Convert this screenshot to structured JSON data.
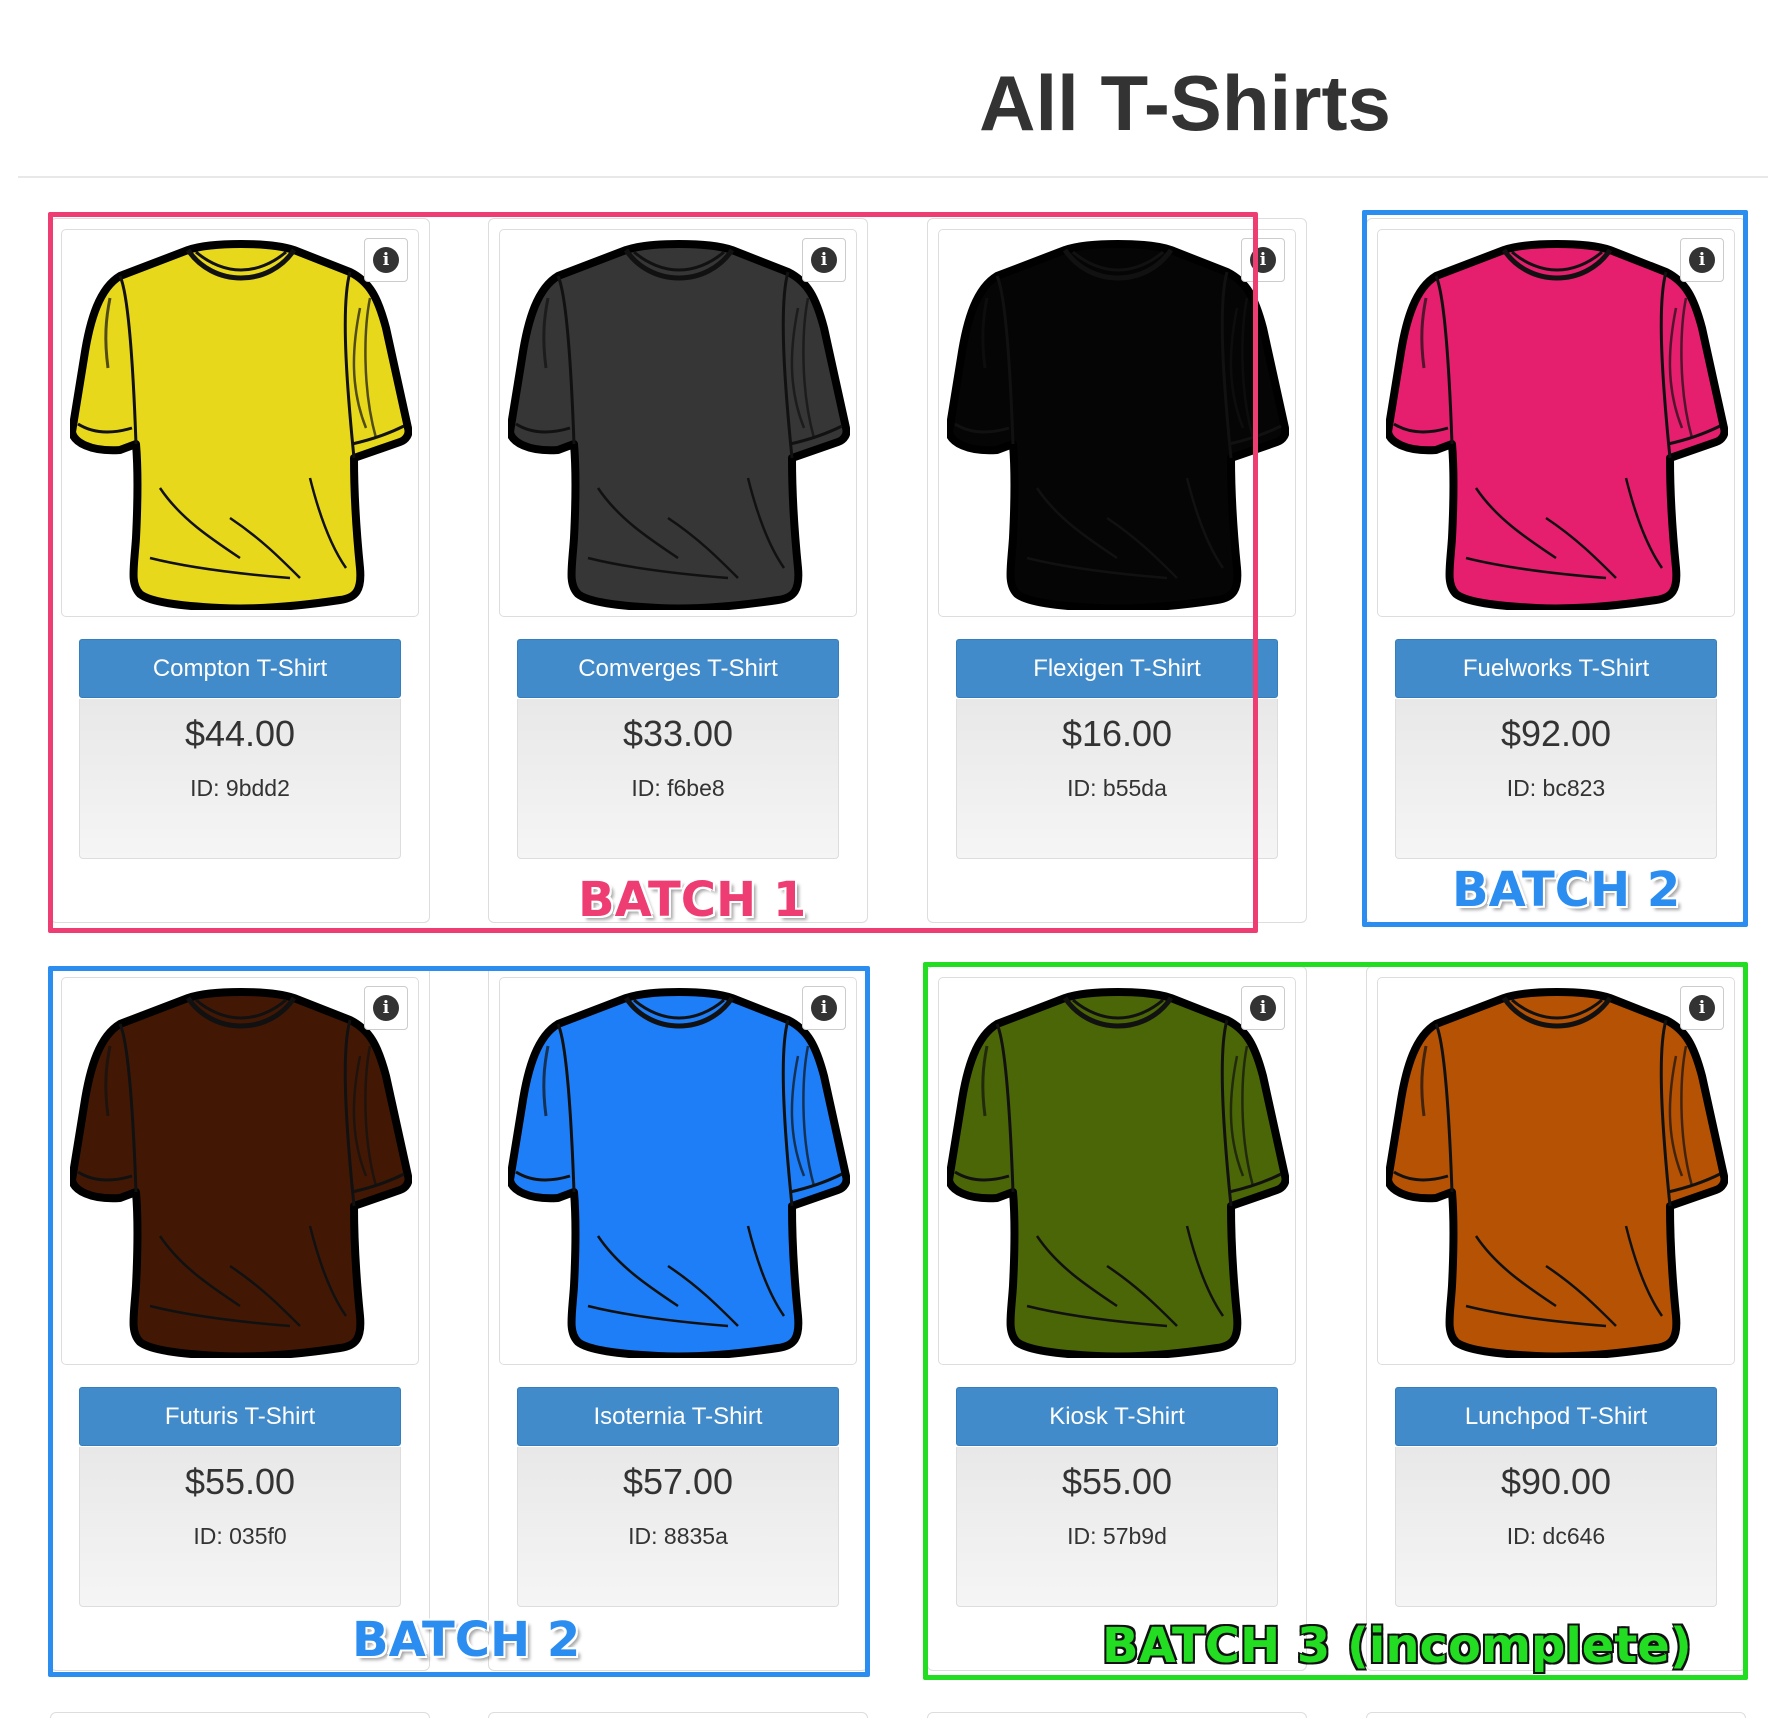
{
  "page": {
    "title": "All T-Shirts"
  },
  "products": [
    {
      "name": "Compton T-Shirt",
      "price": "$44.00",
      "id": "ID: 9bdd2",
      "color": "#e8d81c",
      "info_icon": "i"
    },
    {
      "name": "Comverges T-Shirt",
      "price": "$33.00",
      "id": "ID: f6be8",
      "color": "#363636",
      "info_icon": "i"
    },
    {
      "name": "Flexigen T-Shirt",
      "price": "$16.00",
      "id": "ID: b55da",
      "color": "#050505",
      "info_icon": "i"
    },
    {
      "name": "Fuelworks T-Shirt",
      "price": "$92.00",
      "id": "ID: bc823",
      "color": "#e61e6e",
      "info_icon": "i"
    },
    {
      "name": "Futuris T-Shirt",
      "price": "$55.00",
      "id": "ID: 035f0",
      "color": "#421805",
      "info_icon": "i"
    },
    {
      "name": "Isoternia T-Shirt",
      "price": "$57.00",
      "id": "ID: 8835a",
      "color": "#1e7ef7",
      "info_icon": "i"
    },
    {
      "name": "Kiosk T-Shirt",
      "price": "$55.00",
      "id": "ID: 57b9d",
      "color": "#4b6606",
      "info_icon": "i"
    },
    {
      "name": "Lunchpod T-Shirt",
      "price": "$90.00",
      "id": "ID: dc646",
      "color": "#b65204",
      "info_icon": "i"
    }
  ],
  "batches": [
    {
      "label": "BATCH 1",
      "color": "#ee3d72"
    },
    {
      "label": "BATCH 2",
      "color": "#2b8df0"
    },
    {
      "label": "BATCH 2",
      "color": "#2b8df0"
    },
    {
      "label": "BATCH 3 (incomplete)",
      "color": "#22dd22"
    }
  ]
}
